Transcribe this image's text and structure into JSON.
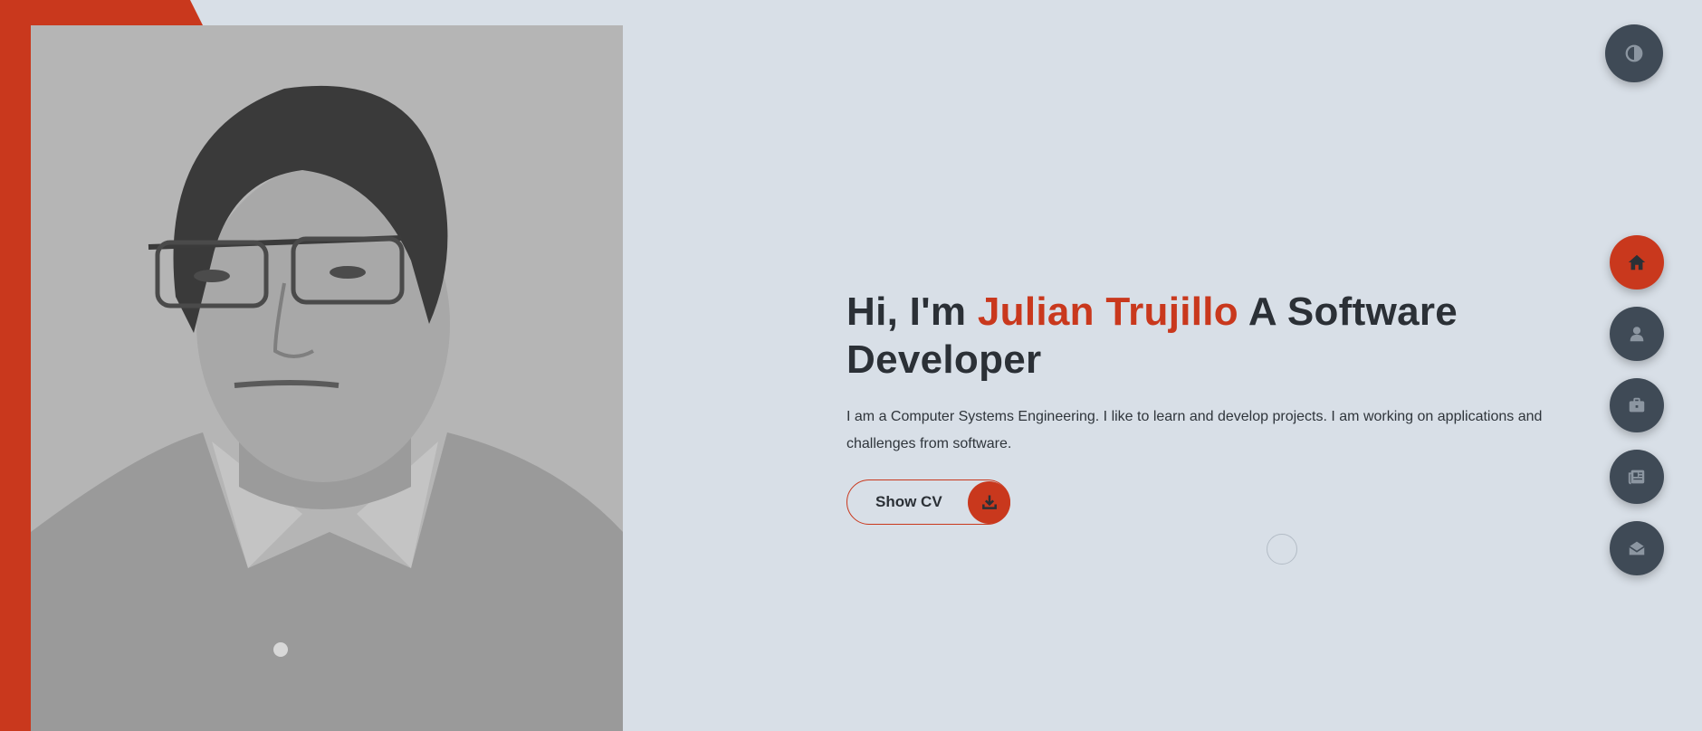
{
  "hero": {
    "greeting": "Hi, I'm ",
    "name": "Julian Trujillo",
    "role": " A Software Developer",
    "description": "I am a Computer Systems Engineering. I like to learn and develop projects. I am working on applications and challenges from software.",
    "cv_button_label": "Show CV"
  },
  "icons": {
    "theme": "contrast-icon",
    "download": "download-icon",
    "nav": [
      "home-icon",
      "user-icon",
      "briefcase-icon",
      "newspaper-icon",
      "mail-open-icon"
    ]
  },
  "nav": {
    "active": "home"
  },
  "colors": {
    "accent": "#c9381d",
    "background": "#d8dfe7",
    "button_dark": "#3f4a56",
    "text": "#2b3036"
  }
}
